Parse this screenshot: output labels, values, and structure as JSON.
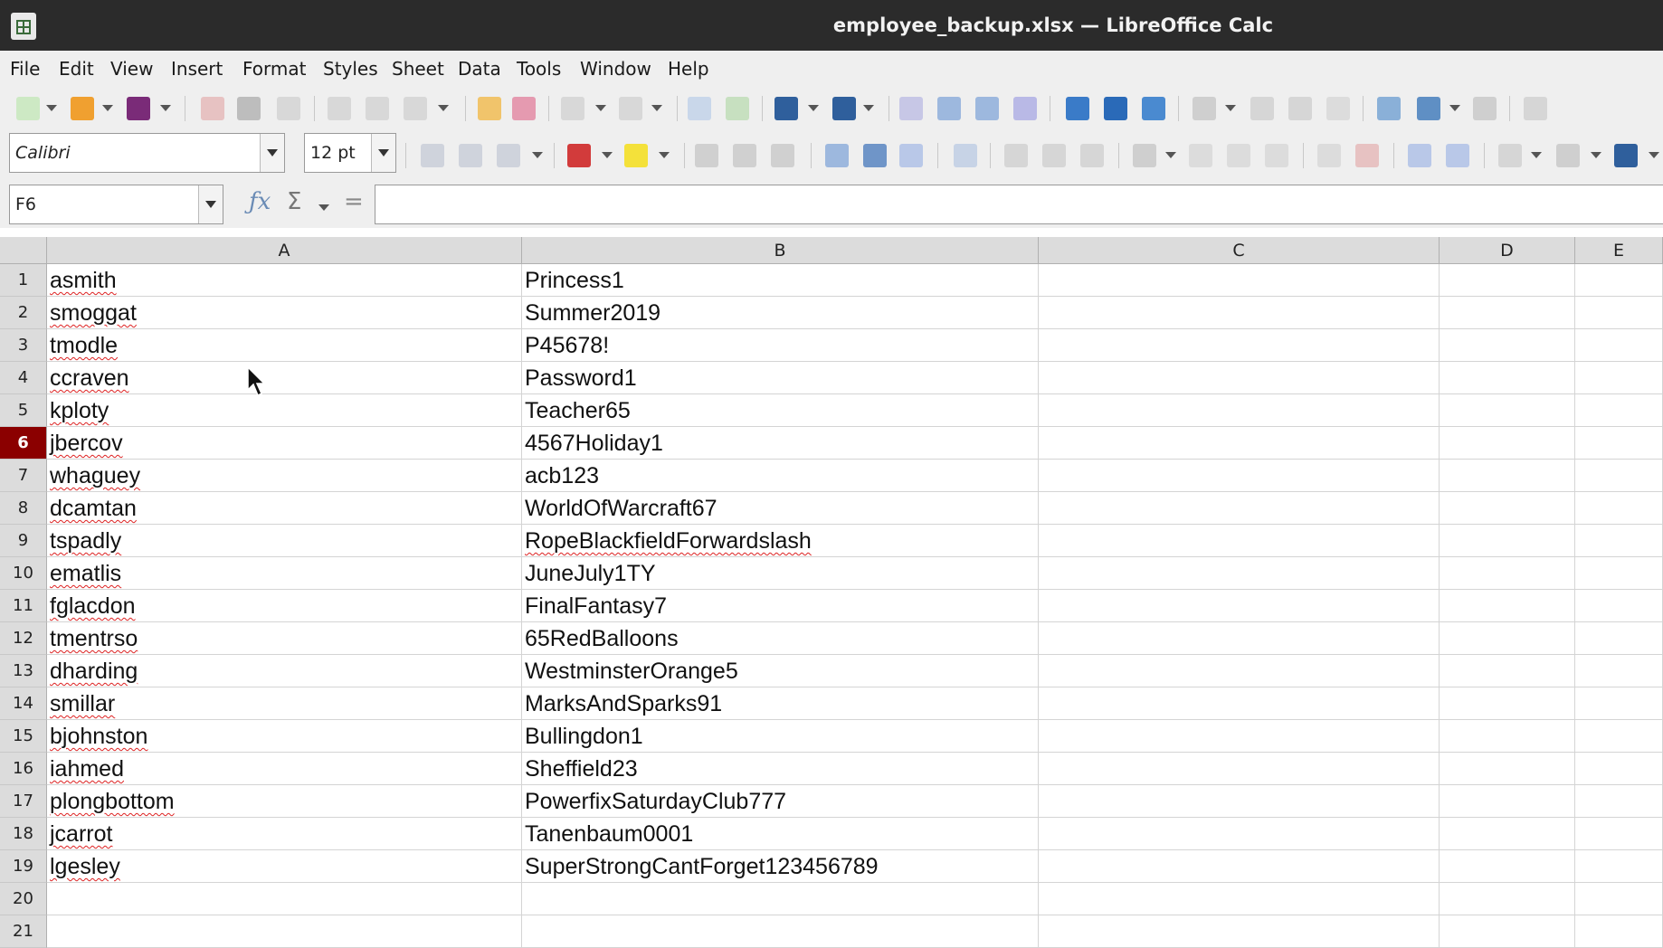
{
  "window": {
    "title": "employee_backup.xlsx — LibreOffice Calc"
  },
  "menu": [
    "File",
    "Edit",
    "View",
    "Insert",
    "Format",
    "Styles",
    "Sheet",
    "Data",
    "Tools",
    "Window",
    "Help"
  ],
  "font": {
    "name": "Calibri",
    "size": "12 pt"
  },
  "namebox": {
    "value": "F6"
  },
  "columns": [
    "A",
    "B",
    "C",
    "D",
    "E"
  ],
  "active_row": 6,
  "rows": [
    {
      "n": "1",
      "a": "asmith",
      "b": "Princess1",
      "spell_b": false
    },
    {
      "n": "2",
      "a": "smoggat",
      "b": "Summer2019",
      "spell_b": false
    },
    {
      "n": "3",
      "a": "tmodle",
      "b": "P45678!",
      "spell_b": false
    },
    {
      "n": "4",
      "a": "ccraven",
      "b": "Password1",
      "spell_b": false
    },
    {
      "n": "5",
      "a": "kploty",
      "b": "Teacher65",
      "spell_b": false
    },
    {
      "n": "6",
      "a": "jbercov",
      "b": "4567Holiday1",
      "spell_b": false
    },
    {
      "n": "7",
      "a": "whaguey",
      "b": "acb123",
      "spell_b": false
    },
    {
      "n": "8",
      "a": "dcamtan",
      "b": "WorldOfWarcraft67",
      "spell_b": false
    },
    {
      "n": "9",
      "a": "tspadly",
      "b": "RopeBlackfieldForwardslash",
      "spell_b": true
    },
    {
      "n": "10",
      "a": "ematlis",
      "b": "JuneJuly1TY",
      "spell_b": false
    },
    {
      "n": "11",
      "a": "fglacdon",
      "b": "FinalFantasy7",
      "spell_b": false
    },
    {
      "n": "12",
      "a": "tmentrso",
      "b": "65RedBalloons",
      "spell_b": false
    },
    {
      "n": "13",
      "a": "dharding",
      "b": "WestminsterOrange5",
      "spell_b": false
    },
    {
      "n": "14",
      "a": "smillar",
      "b": "MarksAndSparks91",
      "spell_b": false
    },
    {
      "n": "15",
      "a": "bjohnston",
      "b": "Bullingdon1",
      "spell_b": false
    },
    {
      "n": "16",
      "a": "iahmed",
      "b": "Sheffield23",
      "spell_b": false
    },
    {
      "n": "17",
      "a": "plongbottom",
      "b": "PowerfixSaturdayClub777",
      "spell_b": false
    },
    {
      "n": "18",
      "a": "jcarrot",
      "b": "Tanenbaum0001",
      "spell_b": false
    },
    {
      "n": "19",
      "a": "lgesley",
      "b": "SuperStrongCantForget123456789",
      "spell_b": false
    },
    {
      "n": "20",
      "a": "",
      "b": "",
      "spell_b": false
    },
    {
      "n": "21",
      "a": "",
      "b": "",
      "spell_b": false
    }
  ]
}
